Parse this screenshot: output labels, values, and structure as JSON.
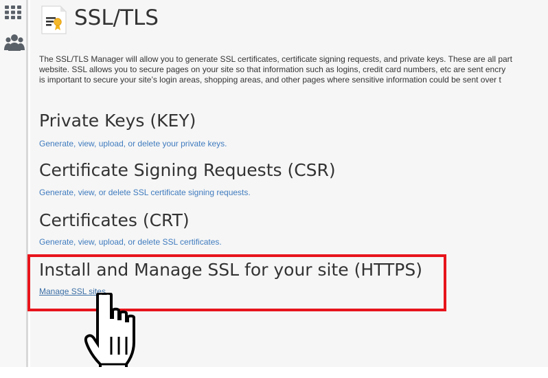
{
  "sidebar": {
    "items": [
      {
        "icon": "apps-grid-icon"
      },
      {
        "icon": "users-icon"
      }
    ]
  },
  "page": {
    "title": "SSL/TLS",
    "icon": "ssl-certificate-icon",
    "intro_lines": [
      "The SSL/TLS Manager will allow you to generate SSL certificates, certificate signing requests, and private keys. These are all part",
      "website. SSL allows you to secure pages on your site so that information such as logins, credit card numbers, etc are sent encry",
      "is important to secure your site’s login areas, shopping areas, and other pages where sensitive information could be sent over t"
    ]
  },
  "sections": [
    {
      "title": "Private Keys (KEY)",
      "link": "Generate, view, upload, or delete your private keys."
    },
    {
      "title": "Certificate Signing Requests (CSR)",
      "link": "Generate, view, or delete SSL certificate signing requests."
    },
    {
      "title": "Certificates (CRT)",
      "link": "Generate, view, upload, or delete SSL certificates."
    },
    {
      "title": "Install and Manage SSL for your site (HTTPS)",
      "link": "Manage SSL sites."
    }
  ],
  "colors": {
    "link": "#3f7bbe",
    "highlight": "#e8141b",
    "text": "#333333",
    "sidebar_icon": "#5a6068"
  }
}
